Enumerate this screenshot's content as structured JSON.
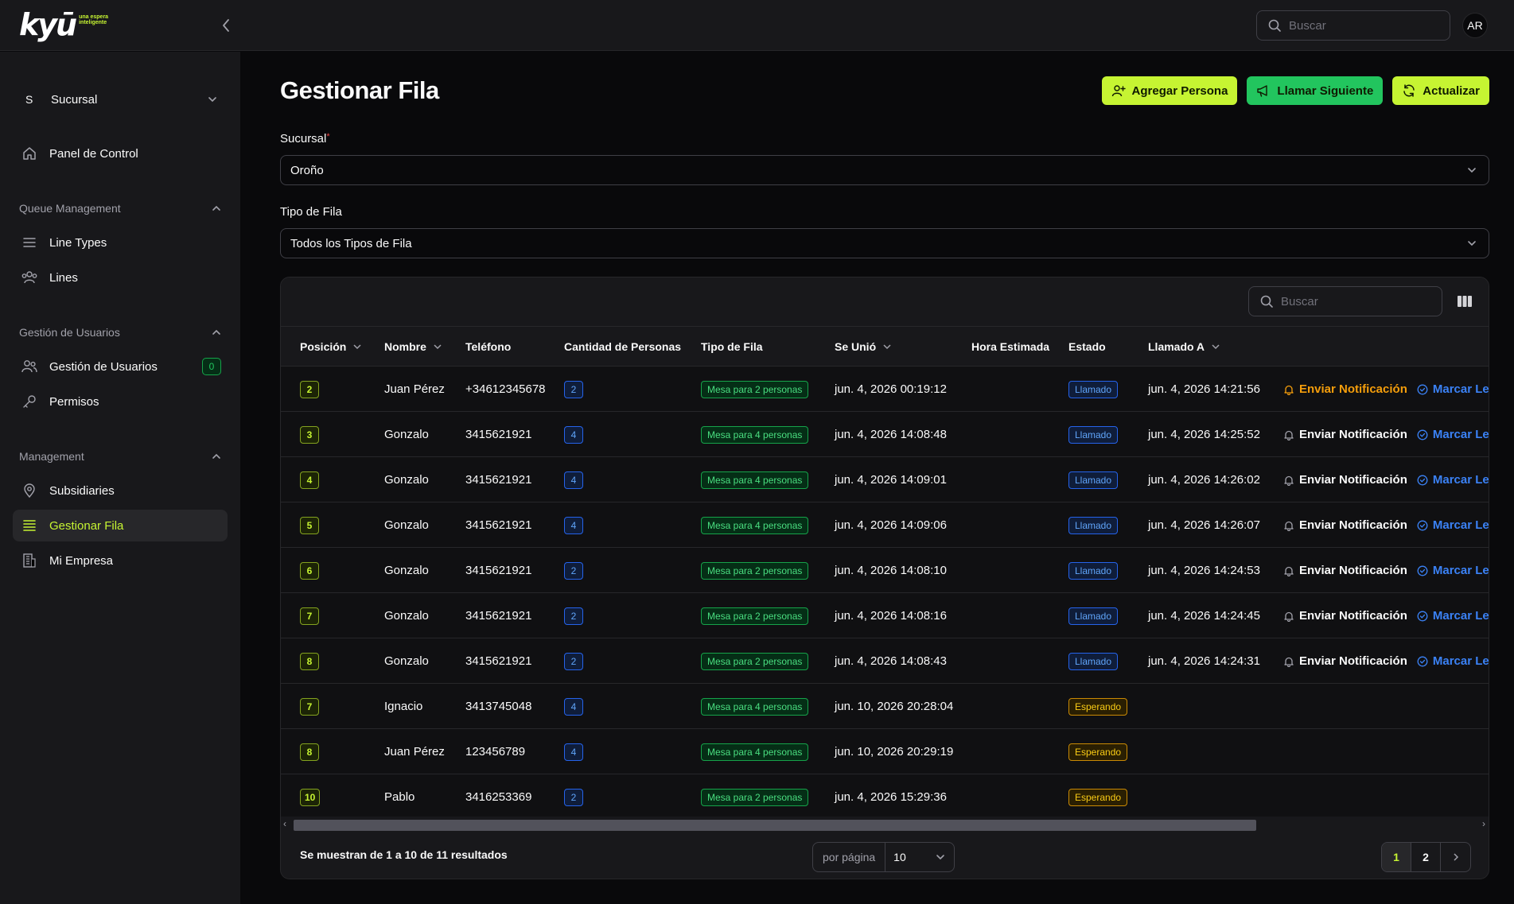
{
  "brand": {
    "logo_text": "kyū",
    "tagline": "una espera inteligente"
  },
  "topbar": {
    "search_placeholder": "Buscar",
    "avatar_initials": "AR"
  },
  "sidebar": {
    "branch": {
      "letter": "S",
      "label": "Sucursal"
    },
    "dashboard": "Panel de Control",
    "groups": [
      {
        "title": "Queue Management",
        "items": [
          "Line Types",
          "Lines"
        ]
      },
      {
        "title": "Gestión de Usuarios",
        "items": [
          "Gestión de Usuarios",
          "Permisos"
        ],
        "badge": "0"
      },
      {
        "title": "Management",
        "items": [
          "Subsidiaries",
          "Gestionar Fila",
          "Mi Empresa"
        ]
      }
    ],
    "active_item": "Gestionar Fila"
  },
  "page": {
    "title": "Gestionar Fila",
    "actions": {
      "add": "Agregar Persona",
      "call_next": "Llamar Siguiente",
      "refresh": "Actualizar"
    },
    "branch_field": {
      "label": "Sucursal",
      "required_mark": "*",
      "value": "Oroño"
    },
    "line_type_field": {
      "label": "Tipo de Fila",
      "value": "Todos los Tipos de Fila"
    }
  },
  "table": {
    "search_placeholder": "Buscar",
    "columns": [
      "Posición",
      "Nombre",
      "Teléfono",
      "Cantidad de Personas",
      "Tipo de Fila",
      "Se Unió",
      "Hora Estimada",
      "Estado",
      "Llamado A"
    ],
    "action_labels": {
      "notify": "Enviar Notificación",
      "mark": "Marcar Leg"
    },
    "rows": [
      {
        "pos": "2",
        "name": "Juan Pérez",
        "phone": "+34612345678",
        "qty": "2",
        "type": "Mesa para 2 personas",
        "joined": "jun. 4, 2026 00:19:12",
        "eta": "",
        "status": "Llamado",
        "called": "jun. 4, 2026 14:21:56",
        "notify_highlight": true
      },
      {
        "pos": "3",
        "name": "Gonzalo",
        "phone": "3415621921",
        "qty": "4",
        "type": "Mesa para 4 personas",
        "joined": "jun. 4, 2026 14:08:48",
        "eta": "",
        "status": "Llamado",
        "called": "jun. 4, 2026 14:25:52"
      },
      {
        "pos": "4",
        "name": "Gonzalo",
        "phone": "3415621921",
        "qty": "4",
        "type": "Mesa para 4 personas",
        "joined": "jun. 4, 2026 14:09:01",
        "eta": "",
        "status": "Llamado",
        "called": "jun. 4, 2026 14:26:02"
      },
      {
        "pos": "5",
        "name": "Gonzalo",
        "phone": "3415621921",
        "qty": "4",
        "type": "Mesa para 4 personas",
        "joined": "jun. 4, 2026 14:09:06",
        "eta": "",
        "status": "Llamado",
        "called": "jun. 4, 2026 14:26:07"
      },
      {
        "pos": "6",
        "name": "Gonzalo",
        "phone": "3415621921",
        "qty": "2",
        "type": "Mesa para 2 personas",
        "joined": "jun. 4, 2026 14:08:10",
        "eta": "",
        "status": "Llamado",
        "called": "jun. 4, 2026 14:24:53"
      },
      {
        "pos": "7",
        "name": "Gonzalo",
        "phone": "3415621921",
        "qty": "2",
        "type": "Mesa para 2 personas",
        "joined": "jun. 4, 2026 14:08:16",
        "eta": "",
        "status": "Llamado",
        "called": "jun. 4, 2026 14:24:45"
      },
      {
        "pos": "8",
        "name": "Gonzalo",
        "phone": "3415621921",
        "qty": "2",
        "type": "Mesa para 2 personas",
        "joined": "jun. 4, 2026 14:08:43",
        "eta": "",
        "status": "Llamado",
        "called": "jun. 4, 2026 14:24:31"
      },
      {
        "pos": "7",
        "name": "Ignacio",
        "phone": "3413745048",
        "qty": "4",
        "type": "Mesa para 4 personas",
        "joined": "jun. 10, 2026 20:28:04",
        "eta": "",
        "status": "Esperando",
        "called": ""
      },
      {
        "pos": "8",
        "name": "Juan Pérez",
        "phone": "123456789",
        "qty": "4",
        "type": "Mesa para 4 personas",
        "joined": "jun. 10, 2026 20:29:19",
        "eta": "",
        "status": "Esperando",
        "called": ""
      },
      {
        "pos": "10",
        "name": "Pablo",
        "phone": "3416253369",
        "qty": "2",
        "type": "Mesa para 2 personas",
        "joined": "jun. 4, 2026 15:29:36",
        "eta": "",
        "status": "Esperando",
        "called": ""
      }
    ]
  },
  "footer": {
    "results_text": "Se muestran de 1 a 10 de 11 resultados",
    "per_page_label": "por página",
    "per_page_value": "10",
    "pages": [
      "1",
      "2"
    ],
    "current_page": "1"
  },
  "colors": {
    "accent": "#c6f432",
    "call_next": "#22c55e",
    "status_called": "#60a5fa",
    "status_waiting": "#facc15"
  }
}
